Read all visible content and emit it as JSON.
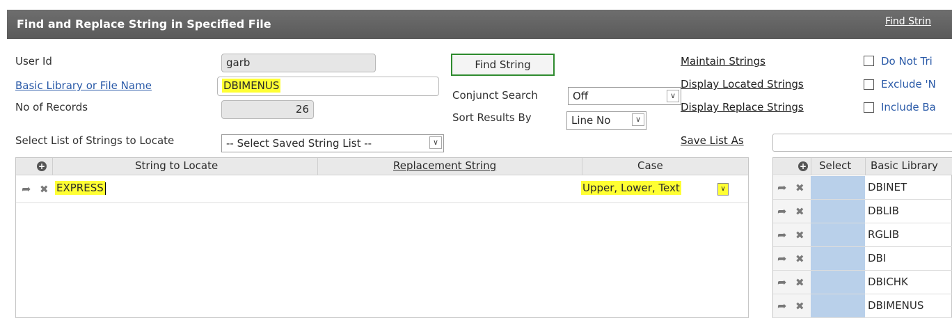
{
  "header": {
    "title": "Find and Replace String in Specified File",
    "right_link": "Find Strin"
  },
  "form": {
    "user_id_label": "User Id",
    "user_id_value": "garb",
    "library_label": "Basic Library or File Name",
    "library_value": "DBIMENUS",
    "records_label": "No of Records",
    "records_value": "26",
    "select_list_label": "Select List of Strings to Locate",
    "select_list_value": "-- Select Saved String List --"
  },
  "actions": {
    "find_button": "Find String",
    "conjunct_label": "Conjunct Search",
    "conjunct_value": "Off",
    "sort_label": "Sort Results By",
    "sort_value": "Line No"
  },
  "links": {
    "maintain": "Maintain Strings",
    "display_located": "Display Located Strings",
    "display_replace": "Display Replace Strings",
    "save_list_as": "Save List As"
  },
  "options": {
    "do_not_trim": "Do Not Tri",
    "exclude": "Exclude 'N",
    "include": "Include Ba"
  },
  "strings_grid": {
    "columns": [
      "String to Locate",
      "Replacement String",
      "Case"
    ],
    "rows": [
      {
        "string": "EXPRESS",
        "replacement": "",
        "case": "Upper, Lower, Text"
      }
    ]
  },
  "library_grid": {
    "columns": [
      "Select",
      "Basic Library"
    ],
    "rows": [
      "DBINET",
      "DBLIB",
      "RGLIB",
      "DBI",
      "DBICHK",
      "DBIMENUS"
    ]
  }
}
